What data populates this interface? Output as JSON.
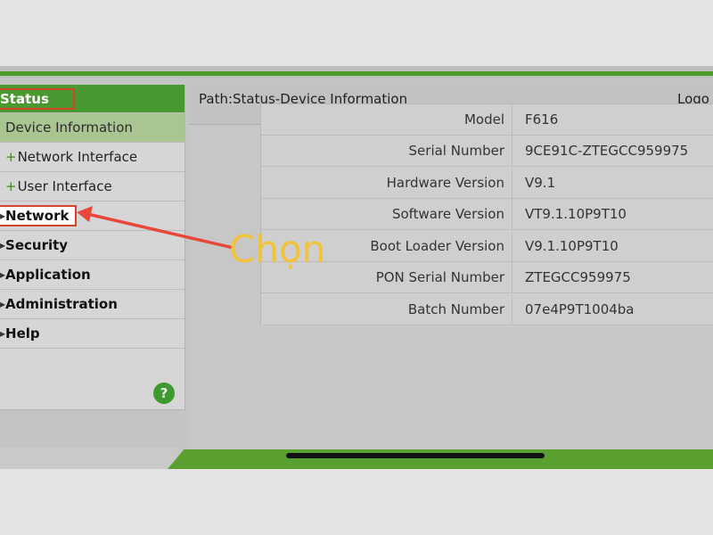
{
  "sidebar": {
    "items": [
      {
        "label": "Status"
      },
      {
        "label": "Device Information"
      },
      {
        "label": "Network Interface"
      },
      {
        "label": "User Interface"
      },
      {
        "label": "Network"
      },
      {
        "label": "Security"
      },
      {
        "label": "Application"
      },
      {
        "label": "Administration"
      },
      {
        "label": "Help"
      }
    ],
    "help_glyph": "?"
  },
  "header": {
    "path": "Path:Status-Device Information",
    "logout": "Logo"
  },
  "device_info": [
    {
      "label": "Model",
      "value": "F616"
    },
    {
      "label": "Serial Number",
      "value": "9CE91C-ZTEGCC959975"
    },
    {
      "label": "Hardware Version",
      "value": "V9.1"
    },
    {
      "label": "Software Version",
      "value": "VT9.1.10P9T10"
    },
    {
      "label": "Boot Loader Version",
      "value": "V9.1.10P9T10"
    },
    {
      "label": "PON Serial Number",
      "value": "ZTEGCC959975"
    },
    {
      "label": "Batch Number",
      "value": "07e4P9T1004ba"
    }
  ],
  "annotation": {
    "text": "Chọn"
  },
  "colors": {
    "accent_green": "#4a9830",
    "highlight_red": "#d2452a",
    "annotation_yellow": "#f2c338"
  }
}
